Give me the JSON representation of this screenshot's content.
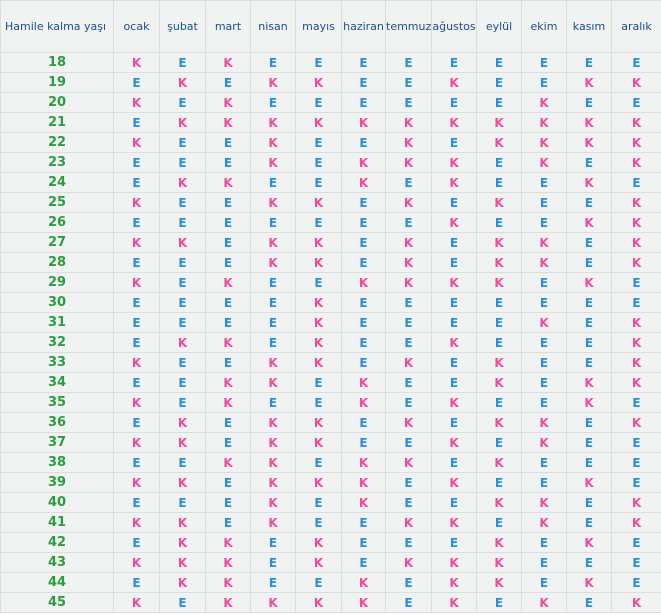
{
  "header": {
    "corner_label": "Hamile kalma yaşı",
    "months": [
      "ocak",
      "şubat",
      "mart",
      "nisan",
      "mayıs",
      "haziran",
      "temmuz",
      "ağustos",
      "eylül",
      "ekim",
      "kasım",
      "aralık"
    ]
  },
  "colors": {
    "K": "#ee4c9e",
    "E": "#2a8ee0",
    "age": "#2a9d3f",
    "header": "#1d4f8a"
  },
  "rows": [
    {
      "age": "18",
      "values": [
        "K",
        "E",
        "K",
        "E",
        "E",
        "E",
        "E",
        "E",
        "E",
        "E",
        "E",
        "E"
      ]
    },
    {
      "age": "19",
      "values": [
        "E",
        "K",
        "E",
        "K",
        "K",
        "E",
        "E",
        "K",
        "E",
        "E",
        "K",
        "K"
      ]
    },
    {
      "age": "20",
      "values": [
        "K",
        "E",
        "K",
        "E",
        "E",
        "E",
        "E",
        "E",
        "E",
        "K",
        "E",
        "E"
      ]
    },
    {
      "age": "21",
      "values": [
        "E",
        "K",
        "K",
        "K",
        "K",
        "K",
        "K",
        "K",
        "K",
        "K",
        "K",
        "K"
      ]
    },
    {
      "age": "22",
      "values": [
        "K",
        "E",
        "E",
        "K",
        "E",
        "E",
        "K",
        "E",
        "K",
        "K",
        "K",
        "K"
      ]
    },
    {
      "age": "23",
      "values": [
        "E",
        "E",
        "E",
        "K",
        "E",
        "K",
        "K",
        "K",
        "E",
        "K",
        "E",
        "K"
      ]
    },
    {
      "age": "24",
      "values": [
        "E",
        "K",
        "K",
        "E",
        "E",
        "K",
        "E",
        "K",
        "E",
        "E",
        "K",
        "E"
      ]
    },
    {
      "age": "25",
      "values": [
        "K",
        "E",
        "E",
        "K",
        "K",
        "E",
        "K",
        "E",
        "K",
        "E",
        "E",
        "K"
      ]
    },
    {
      "age": "26",
      "values": [
        "E",
        "E",
        "E",
        "E",
        "E",
        "E",
        "E",
        "K",
        "E",
        "E",
        "K",
        "K"
      ]
    },
    {
      "age": "27",
      "values": [
        "K",
        "K",
        "E",
        "K",
        "K",
        "E",
        "K",
        "E",
        "K",
        "K",
        "E",
        "K"
      ]
    },
    {
      "age": "28",
      "values": [
        "E",
        "E",
        "E",
        "K",
        "K",
        "E",
        "K",
        "E",
        "K",
        "K",
        "E",
        "K"
      ]
    },
    {
      "age": "29",
      "values": [
        "K",
        "E",
        "K",
        "E",
        "E",
        "K",
        "K",
        "K",
        "K",
        "E",
        "K",
        "E"
      ]
    },
    {
      "age": "30",
      "values": [
        "E",
        "E",
        "E",
        "E",
        "K",
        "E",
        "E",
        "E",
        "E",
        "E",
        "E",
        "E"
      ]
    },
    {
      "age": "31",
      "values": [
        "E",
        "E",
        "E",
        "E",
        "K",
        "E",
        "E",
        "E",
        "E",
        "K",
        "E",
        "K"
      ]
    },
    {
      "age": "32",
      "values": [
        "E",
        "K",
        "K",
        "E",
        "K",
        "E",
        "E",
        "K",
        "E",
        "E",
        "E",
        "K"
      ]
    },
    {
      "age": "33",
      "values": [
        "K",
        "E",
        "E",
        "K",
        "K",
        "E",
        "K",
        "E",
        "K",
        "E",
        "E",
        "K"
      ]
    },
    {
      "age": "34",
      "values": [
        "E",
        "E",
        "K",
        "K",
        "E",
        "K",
        "E",
        "E",
        "K",
        "E",
        "K",
        "K"
      ]
    },
    {
      "age": "35",
      "values": [
        "K",
        "E",
        "K",
        "E",
        "E",
        "K",
        "E",
        "K",
        "E",
        "E",
        "K",
        "E"
      ]
    },
    {
      "age": "36",
      "values": [
        "E",
        "K",
        "E",
        "K",
        "K",
        "E",
        "K",
        "E",
        "K",
        "K",
        "E",
        "K"
      ]
    },
    {
      "age": "37",
      "values": [
        "K",
        "K",
        "E",
        "K",
        "K",
        "E",
        "E",
        "K",
        "E",
        "K",
        "E",
        "E"
      ]
    },
    {
      "age": "38",
      "values": [
        "E",
        "E",
        "K",
        "K",
        "E",
        "K",
        "K",
        "E",
        "K",
        "E",
        "E",
        "E"
      ]
    },
    {
      "age": "39",
      "values": [
        "K",
        "K",
        "E",
        "K",
        "K",
        "K",
        "E",
        "K",
        "E",
        "E",
        "K",
        "E"
      ]
    },
    {
      "age": "40",
      "values": [
        "E",
        "E",
        "E",
        "K",
        "E",
        "K",
        "E",
        "E",
        "K",
        "K",
        "E",
        "K"
      ]
    },
    {
      "age": "41",
      "values": [
        "K",
        "K",
        "E",
        "K",
        "E",
        "E",
        "K",
        "K",
        "E",
        "K",
        "E",
        "K"
      ]
    },
    {
      "age": "42",
      "values": [
        "E",
        "K",
        "K",
        "E",
        "K",
        "E",
        "E",
        "E",
        "K",
        "E",
        "K",
        "E"
      ]
    },
    {
      "age": "43",
      "values": [
        "K",
        "K",
        "K",
        "E",
        "K",
        "E",
        "K",
        "K",
        "K",
        "E",
        "E",
        "E"
      ]
    },
    {
      "age": "44",
      "values": [
        "E",
        "K",
        "K",
        "E",
        "E",
        "K",
        "E",
        "K",
        "K",
        "E",
        "K",
        "E"
      ]
    },
    {
      "age": "45",
      "values": [
        "K",
        "E",
        "K",
        "K",
        "K",
        "K",
        "E",
        "K",
        "E",
        "K",
        "E",
        "K"
      ]
    }
  ]
}
